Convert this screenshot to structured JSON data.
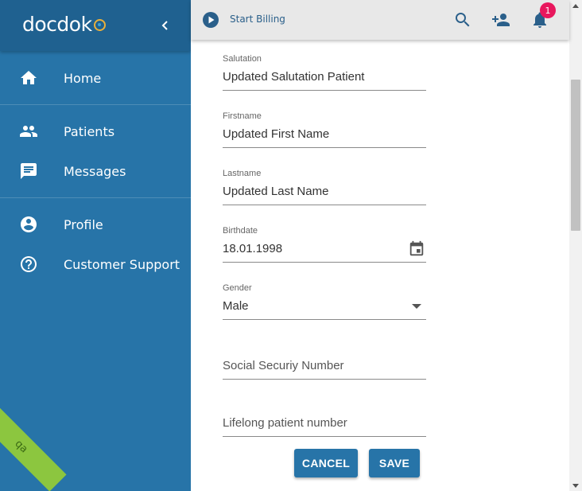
{
  "sidebar": {
    "brand": "docdok",
    "items": [
      {
        "label": "Home",
        "icon": "home-icon"
      },
      {
        "label": "Patients",
        "icon": "people-icon"
      },
      {
        "label": "Messages",
        "icon": "message-icon"
      },
      {
        "label": "Profile",
        "icon": "account-circle-icon"
      },
      {
        "label": "Customer Support",
        "icon": "help-circle-icon"
      }
    ],
    "env_ribbon": "qa"
  },
  "topbar": {
    "billing_label": "Start Billing",
    "notification_count": "1"
  },
  "form": {
    "salutation": {
      "label": "Salutation",
      "value": "Updated Salutation Patient"
    },
    "firstname": {
      "label": "Firstname",
      "value": "Updated First Name"
    },
    "lastname": {
      "label": "Lastname",
      "value": "Updated Last Name"
    },
    "birthdate": {
      "label": "Birthdate",
      "value": "18.01.1998"
    },
    "gender": {
      "label": "Gender",
      "value": "Male"
    },
    "ssn": {
      "placeholder": "Social Securiy Number"
    },
    "lifelong": {
      "placeholder": "Lifelong patient number"
    },
    "cancel_label": "CANCEL",
    "save_label": "SAVE"
  },
  "colors": {
    "sidebar": "#2774a8",
    "sidebar_header": "#1f6190",
    "button": "#2774a8",
    "badge": "#e8175d",
    "ribbon": "#8cc63f"
  }
}
